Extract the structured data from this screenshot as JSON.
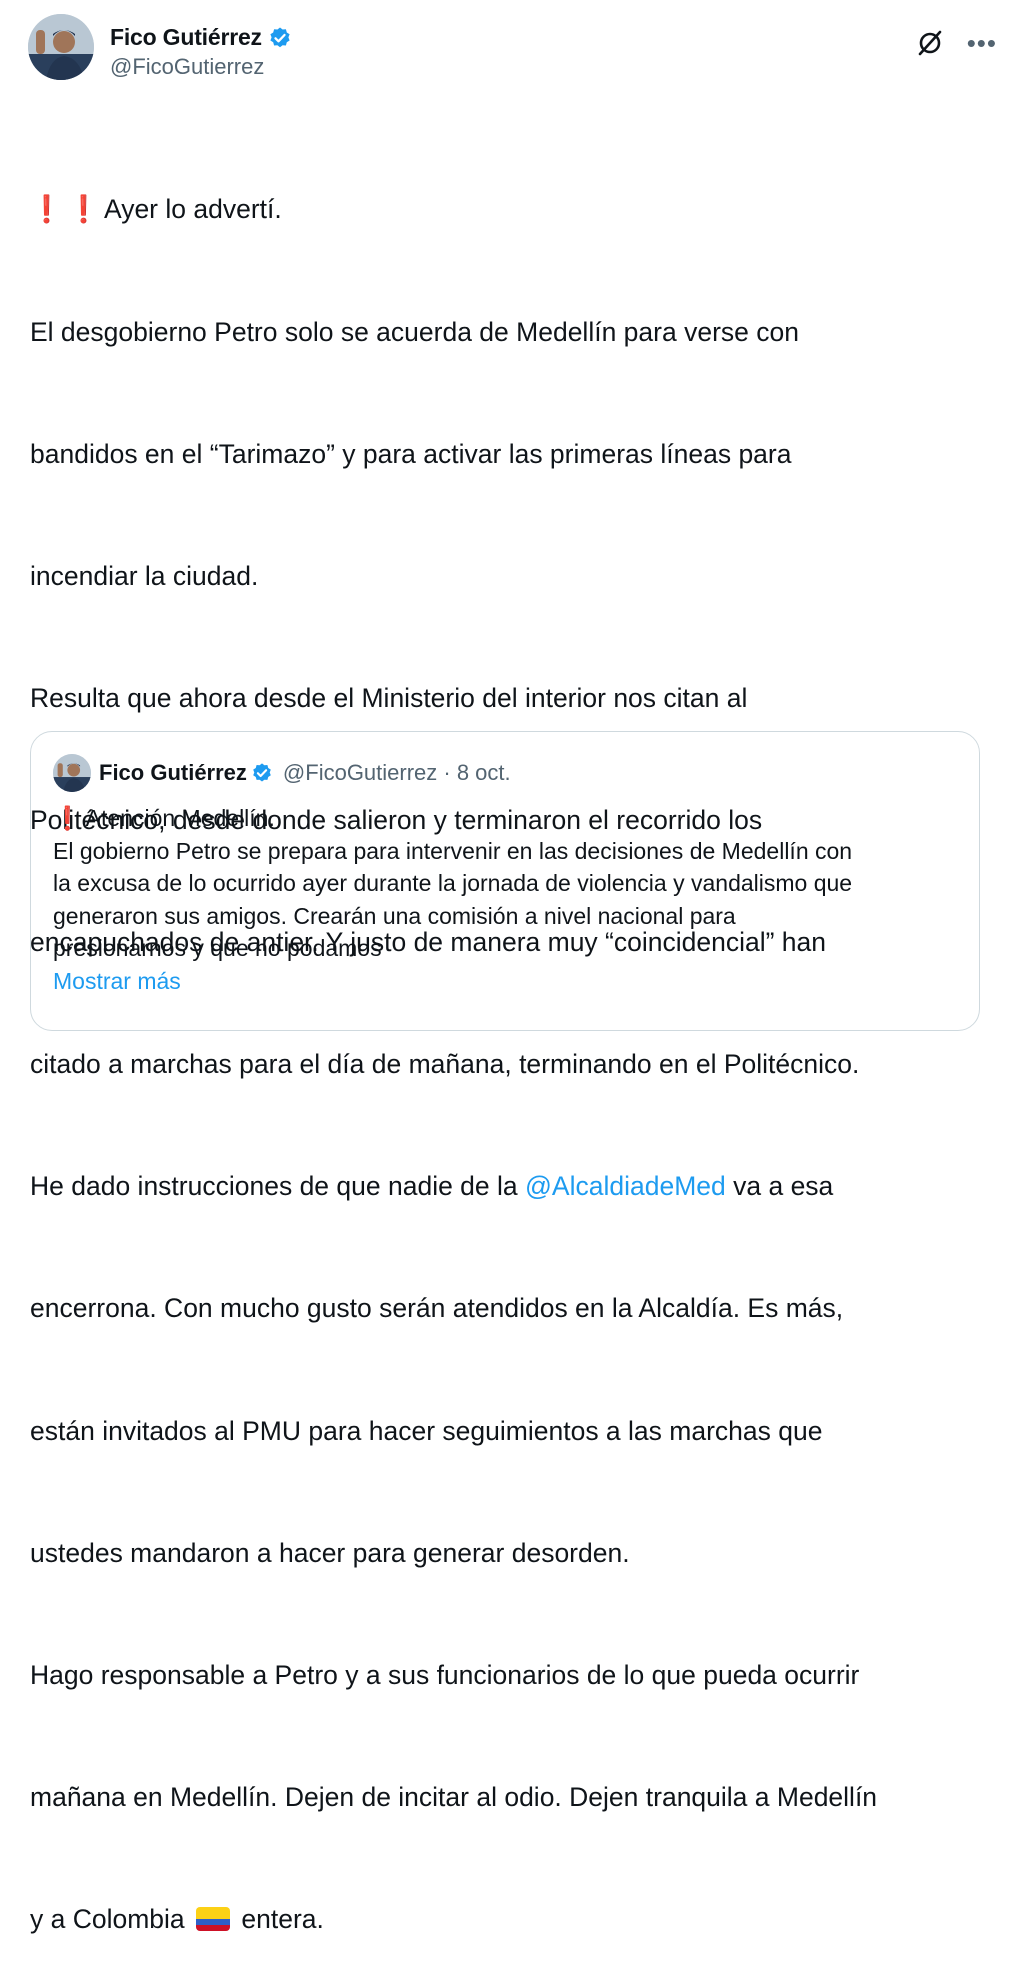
{
  "author": {
    "name": "Fico Gutiérrez",
    "handle": "@FicoGutierrez"
  },
  "icons": {
    "verified": "verified-badge-icon",
    "grok": "grok-icon",
    "more": "more-options-icon",
    "alert": "exclamation-icon",
    "flag": "colombia-flag-icon"
  },
  "colors": {
    "link": "#1d9bf0",
    "verified": "#1d9bf0",
    "secondary_text": "#536471",
    "alert": "#e0182a"
  },
  "tweet": {
    "lines": [
      "Ayer lo advertí.",
      "El desgobierno Petro solo se acuerda de Medellín para verse con",
      "bandidos en el “Tarimazo” y para activar las primeras líneas para",
      "incendiar la ciudad.",
      "Resulta que ahora desde el Ministerio del interior nos citan al",
      "Politécnico, desde donde salieron y terminaron el recorrido los",
      "encapuchados de antier. Y justo de manera muy “coincidencial” han",
      "citado a marchas para el día de mañana, terminando en el Politécnico.",
      "He dado instrucciones  de que nadie de la ",
      "@AlcaldiadeMed",
      " va a esa",
      "encerrona. Con mucho gusto serán atendidos en la Alcaldía. Es más,",
      "están invitados al PMU para hacer seguimientos a las marchas que",
      "ustedes mandaron a hacer para generar desorden.",
      "Hago responsable a Petro y a sus funcionarios de lo que pueda ocurrir",
      "mañana en Medellín. Dejen de incitar al odio. Dejen tranquila a Medellín",
      "y a Colombia ",
      " entera."
    ],
    "alert_glyph": "❗",
    "alert_glyph_2": "❗"
  },
  "quoted": {
    "name": "Fico Gutiérrez",
    "handle_date": "@FicoGutierrez · 8 oct.",
    "alert_glyph": "❗",
    "lines": [
      "Atención Medellín.",
      "El gobierno Petro se prepara para intervenir en las decisiones de Medellín con",
      "la excusa de lo ocurrido ayer durante la jornada de violencia y vandalismo que",
      "generaron sus amigos. Crearán una comisión a nivel nacional para",
      "presionarnos y que no podamos"
    ],
    "show_more": "Mostrar más"
  }
}
